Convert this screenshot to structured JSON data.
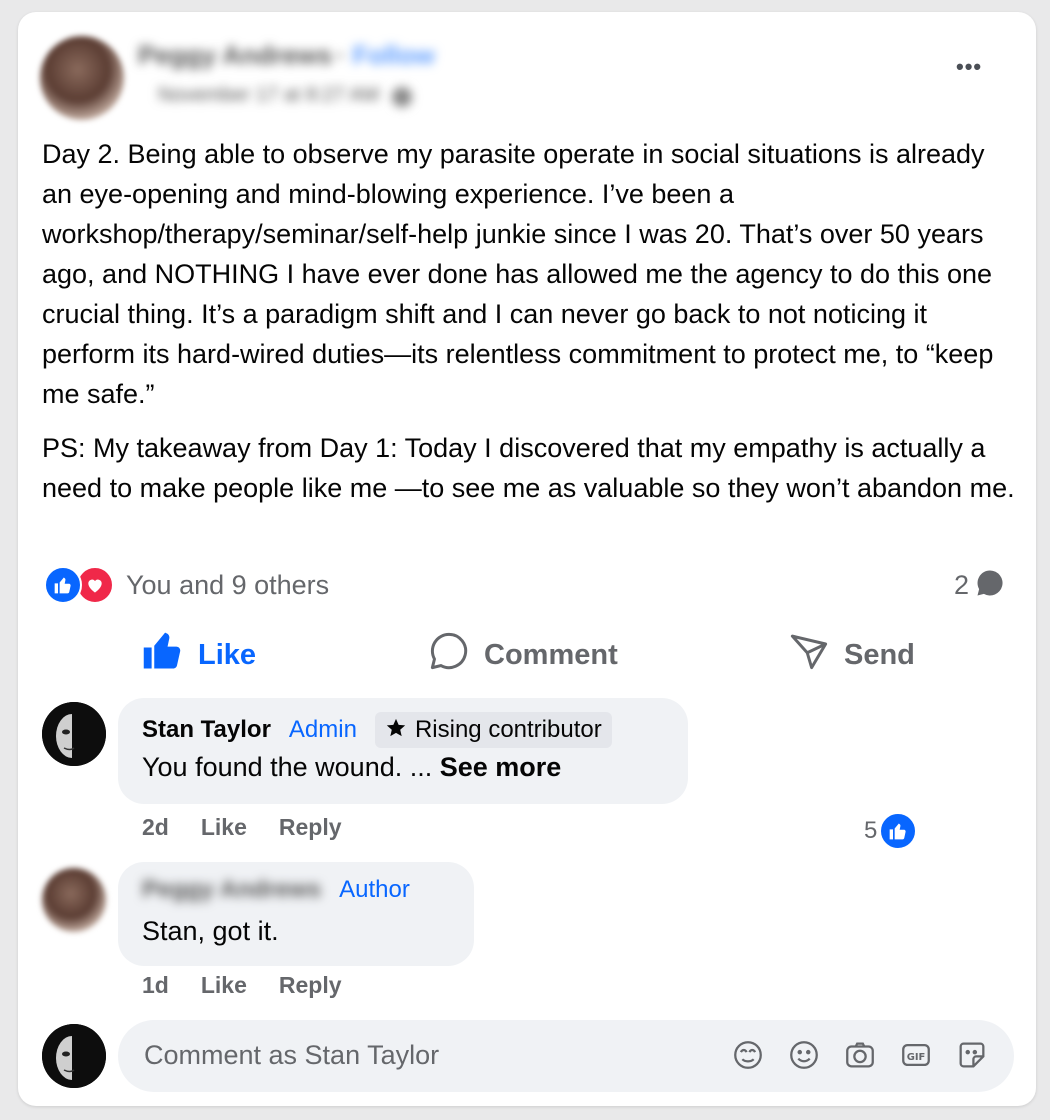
{
  "post": {
    "author_name": "Peggy Andrews",
    "follow_label": "Follow",
    "timestamp": "November 17 at 8:27 AM",
    "more_label": "•••",
    "paragraphs": [
      "Day 2. Being able to observe my parasite operate in social situations is already an eye-opening and mind-blowing experience. I’ve been a workshop/therapy/seminar/self-help junkie since I was 20. That’s over 50 years ago, and NOTHING I have ever done has allowed me the agency to do this one crucial thing. It’s a paradigm shift and I can never go back to not noticing it perform its hard-wired duties—its relentless commitment to protect me, to “keep me safe.”",
      "PS: My takeaway from Day 1:  Today I discovered that my empathy is actually a need to make people like me —to see me as valuable so they won’t abandon me."
    ]
  },
  "reactions": {
    "summary": "You and 9 others",
    "comment_count": "2"
  },
  "actions": {
    "like": "Like",
    "comment": "Comment",
    "send": "Send"
  },
  "comments": [
    {
      "name": "Stan Taylor",
      "role": "Admin",
      "badge": "Rising contributor",
      "text": "You found the wound. ... ",
      "see_more": "See more",
      "time": "2d",
      "like": "Like",
      "reply": "Reply",
      "like_count": "5"
    },
    {
      "name": "Peggy Andrews",
      "role": "Author",
      "text": "Stan, got it.",
      "time": "1d",
      "like": "Like",
      "reply": "Reply"
    }
  ],
  "composer": {
    "placeholder": "Comment as Stan Taylor",
    "icons": [
      "avatar-sticker-icon",
      "emoji-icon",
      "camera-icon",
      "gif-icon",
      "sticker-icon"
    ]
  },
  "colors": {
    "accent": "#0866ff",
    "love": "#f02849",
    "muted": "#65676b"
  }
}
